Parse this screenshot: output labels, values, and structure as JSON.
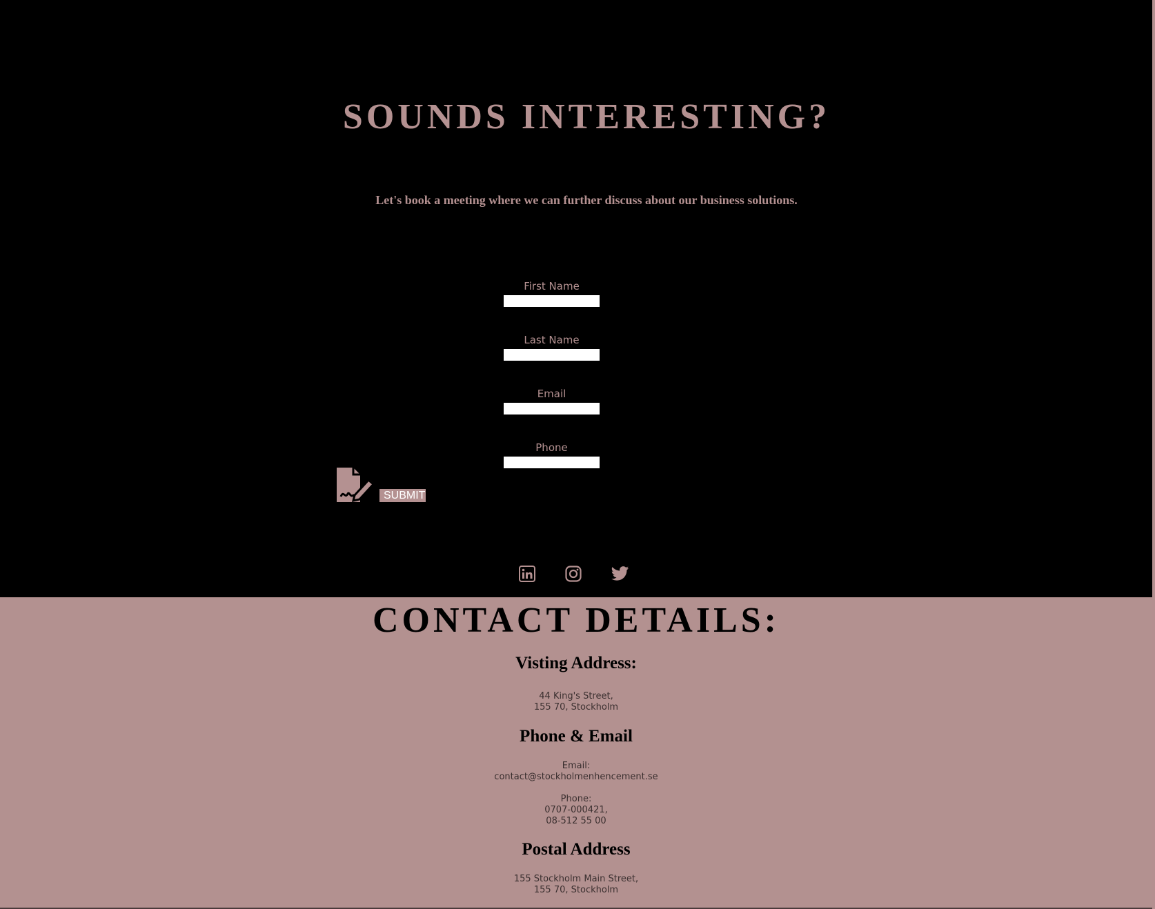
{
  "hero": {
    "title": "SOUNDS INTERESTING?",
    "subtitle": "Let's book a meeting where we can further discuss about our business solutions."
  },
  "form": {
    "first_name_label": "First Name",
    "last_name_label": "Last Name",
    "email_label": "Email",
    "phone_label": "Phone",
    "submit_label": "SUBMIT",
    "submit_icon": "signature-document-icon"
  },
  "social": {
    "icons": [
      "linkedin-icon",
      "instagram-icon",
      "twitter-icon"
    ]
  },
  "contact": {
    "title": "CONTACT DETAILS:",
    "visiting_heading": "Visting Address:",
    "visiting_line1": "44 King's Street,",
    "visiting_line2": "155 70, Stockholm",
    "phone_email_heading": "Phone & Email",
    "email_label": "Email:",
    "email_value": "contact@stockholmenhencement.se",
    "phone_label": "Phone:",
    "phone_value1": "0707-000421,",
    "phone_value2": "08-512 55 00",
    "postal_heading": "Postal Address",
    "postal_line1": "155 Stockholm Main Street,",
    "postal_line2": "155 70, Stockholm"
  },
  "colors": {
    "accent": "#b49191",
    "top_background": "#000000",
    "bottom_background": "#b39190"
  }
}
